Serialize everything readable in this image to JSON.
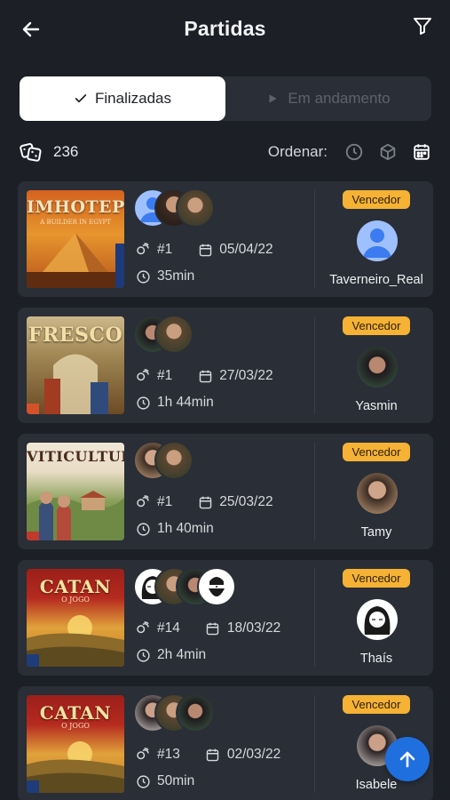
{
  "header": {
    "title": "Partidas",
    "back_icon": "arrow-left-icon",
    "filter_icon": "filter-icon"
  },
  "tabs": [
    {
      "label": "Finalizadas",
      "icon": "check-icon",
      "active": true
    },
    {
      "label": "Em andamento",
      "icon": "play-icon",
      "active": false
    }
  ],
  "stats": {
    "count": "236",
    "icon": "dice-icon"
  },
  "sort": {
    "label": "Ordenar:",
    "options": [
      "clock-icon",
      "box-icon",
      "calendar-icon"
    ],
    "active": "calendar-icon"
  },
  "matches": [
    {
      "game": "IMHOTEP",
      "cover_sub": "A BUILDER IN EGYPT",
      "rank": "#1",
      "date": "05/04/22",
      "duration": "35min",
      "badge": "Vencedor",
      "winner": "Taverneiro_Real"
    },
    {
      "game": "FRESCO",
      "cover_sub": "",
      "rank": "#1",
      "date": "27/03/22",
      "duration": "1h 44min",
      "badge": "Vencedor",
      "winner": "Yasmin"
    },
    {
      "game": "VITICULTURE",
      "cover_sub": "",
      "rank": "#1",
      "date": "25/03/22",
      "duration": "1h 40min",
      "badge": "Vencedor",
      "winner": "Tamy"
    },
    {
      "game": "CATAN",
      "cover_sub": "O JOGO",
      "rank": "#14",
      "date": "18/03/22",
      "duration": "2h 4min",
      "badge": "Vencedor",
      "winner": "Thaís"
    },
    {
      "game": "CATAN",
      "cover_sub": "O JOGO",
      "rank": "#13",
      "date": "02/03/22",
      "duration": "50min",
      "badge": "Vencedor",
      "winner": "Isabele"
    }
  ],
  "colors": {
    "background": "#1c1f26",
    "card": "#2a2e36",
    "accent": "#f5b235",
    "fab": "#1f6fde"
  },
  "fab": {
    "icon": "arrow-up-icon"
  }
}
